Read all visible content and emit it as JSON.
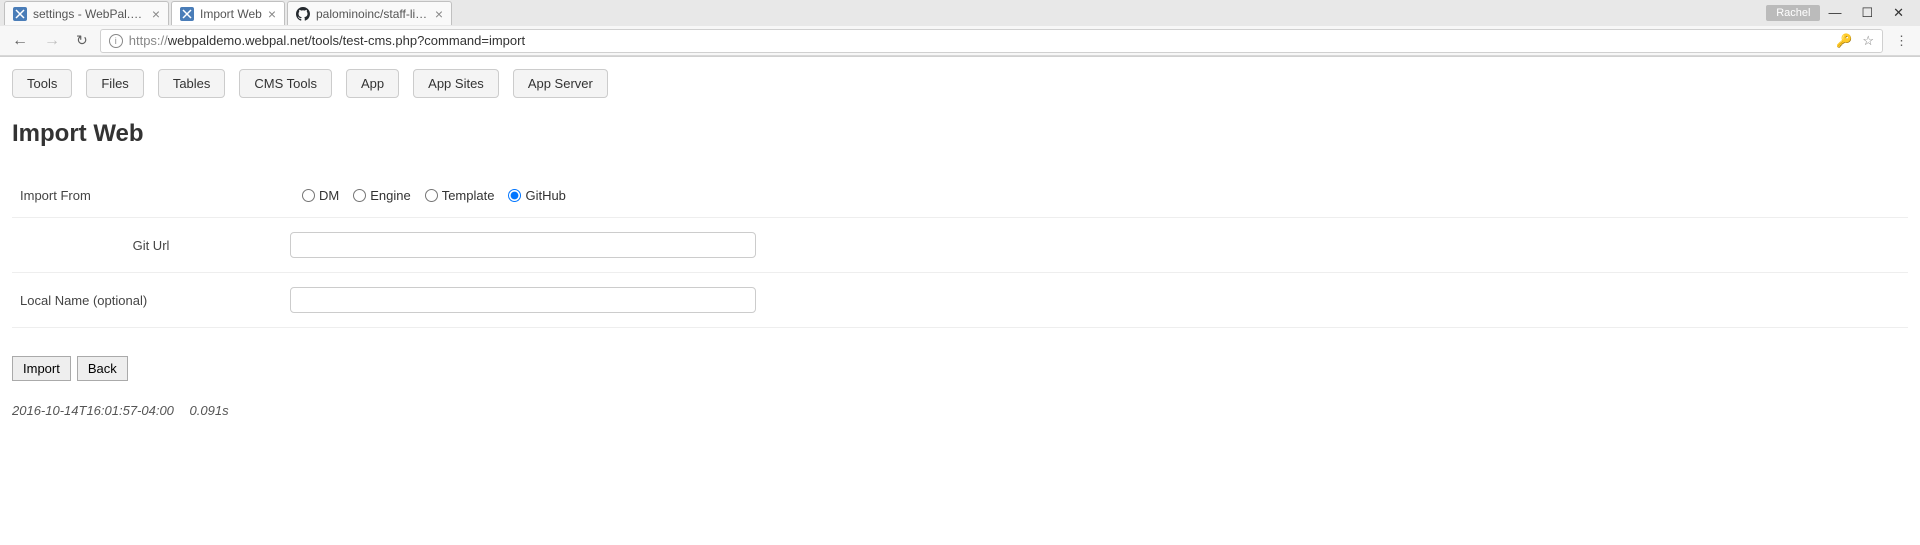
{
  "window": {
    "user_badge": "Rachel"
  },
  "tabs": [
    {
      "title": "settings - WebPal.net Clo",
      "favicon_color": "#4a7db8"
    },
    {
      "title": "Import Web",
      "favicon_color": "#4a7db8"
    },
    {
      "title": "palominoinc/staff-list: Lis",
      "favicon_color": "#24292e"
    }
  ],
  "address_bar": {
    "url_prefix": "https://",
    "url_main": "webpaldemo.webpal.net/tools/test-cms.php?command=import"
  },
  "toolbar": [
    "Tools",
    "Files",
    "Tables",
    "CMS Tools",
    "App",
    "App Sites",
    "App Server"
  ],
  "page": {
    "heading": "Import Web",
    "fields": {
      "import_from_label": "Import From",
      "import_from_options": [
        "DM",
        "Engine",
        "Template",
        "GitHub"
      ],
      "import_from_selected": "GitHub",
      "git_url_label": "Git Url",
      "git_url_value": "",
      "local_name_label": "Local Name (optional)",
      "local_name_value": ""
    },
    "actions": {
      "import": "Import",
      "back": "Back"
    },
    "footer": {
      "timestamp": "2016-10-14T16:01:57-04:00",
      "duration": "0.091s"
    }
  }
}
